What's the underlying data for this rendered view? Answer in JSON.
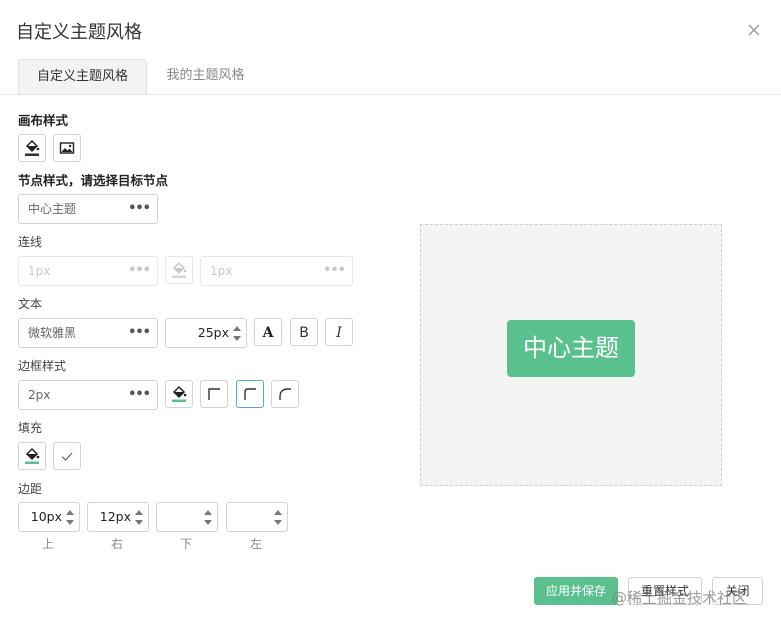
{
  "dialog": {
    "title": "自定义主题风格",
    "tabs": [
      {
        "label": "自定义主题风格",
        "active": true
      },
      {
        "label": "我的主题风格",
        "active": false
      }
    ]
  },
  "canvas_section": {
    "label": "画布样式"
  },
  "node_section": {
    "label": "节点样式，请选择目标节点",
    "node_select": "中心主题"
  },
  "line": {
    "label": "连线",
    "width_value": "1px",
    "style_value": "1px"
  },
  "text": {
    "label": "文本",
    "font_value": "微软雅黑",
    "size_value": "25px"
  },
  "border": {
    "label": "边框样式",
    "width_value": "2px"
  },
  "fill": {
    "label": "填充"
  },
  "padding": {
    "label": "边距",
    "fields": [
      {
        "value": "10px",
        "caption": "上"
      },
      {
        "value": "12px",
        "caption": "右"
      },
      {
        "value": "",
        "caption": "下"
      },
      {
        "value": "",
        "caption": "左"
      }
    ]
  },
  "preview": {
    "node_text": "中心主题"
  },
  "footer": {
    "apply_save": "应用并保存",
    "reset": "重置样式",
    "close": "关闭"
  },
  "watermark": "@稀土掘金技术社区",
  "colors": {
    "accent": "#5ac18e",
    "active_border": "#5aa3e0"
  }
}
